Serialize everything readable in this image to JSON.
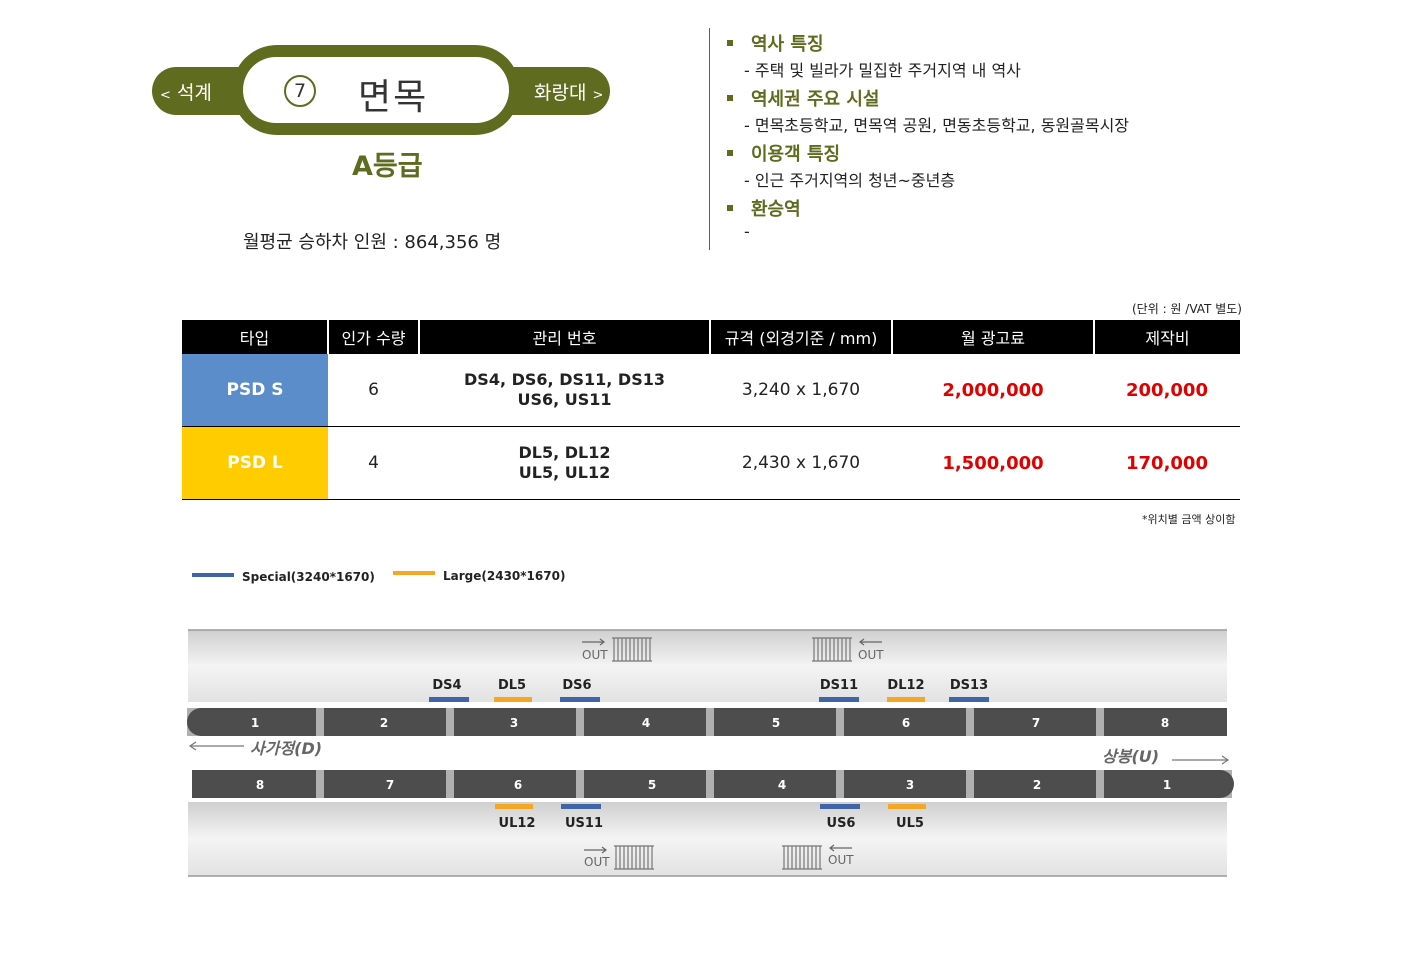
{
  "station": {
    "prev": "석계",
    "prev_arrow": "<",
    "next": "화랑대",
    "next_arrow": ">",
    "number": "7",
    "name": "면목",
    "grade": "A등급",
    "monthly_passengers": "월평균 승하차 인원 : 864,356 명"
  },
  "info": [
    {
      "title": "역사 특징",
      "desc": "-  주택 및 빌라가 밀집한 주거지역 내 역사"
    },
    {
      "title": "역세권 주요 시설",
      "desc": "-  면목초등학교, 면목역 공원, 면동초등학교, 동원골목시장"
    },
    {
      "title": "이용객 특징",
      "desc": "-  인근 주거지역의 청년~중년층"
    },
    {
      "title": "환승역",
      "desc": "-"
    }
  ],
  "unit_note": "(단위 : 원 /VAT 별도)",
  "price_note": "*위치별 금액 상이함",
  "table": {
    "headers": [
      "타입",
      "인가 수량",
      "관리 번호",
      "규격 (외경기준 / mm)",
      "월 광고료",
      "제작비"
    ],
    "rows": [
      {
        "type": "PSD S",
        "qty": "6",
        "mgmt1": "DS4, DS6, DS11, DS13",
        "mgmt2": "US6, US11",
        "size": "3,240  x  1,670",
        "monthly": "2,000,000",
        "production": "200,000"
      },
      {
        "type": "PSD L",
        "qty": "4",
        "mgmt1": "DL5, DL12",
        "mgmt2": "UL5, UL12",
        "size": "2,430  x  1,670",
        "monthly": "1,500,000",
        "production": "170,000"
      }
    ]
  },
  "legend": {
    "special": "Special(3240*1670)",
    "large": "Large(2430*1670)",
    "special_color": "#3f64a8",
    "large_color": "#f5a623"
  },
  "diagram": {
    "out": "OUT",
    "dir_down": "사가정(D)",
    "dir_up": "상봉(U)",
    "top_cars": [
      "1",
      "2",
      "3",
      "4",
      "5",
      "6",
      "7",
      "8"
    ],
    "bottom_cars": [
      "8",
      "7",
      "6",
      "5",
      "4",
      "3",
      "2",
      "1"
    ],
    "top_labels": [
      "DS4",
      "DL5",
      "DS6",
      "DS11",
      "DL12",
      "DS13"
    ],
    "bottom_labels": [
      "UL12",
      "US11",
      "US6",
      "UL5"
    ]
  }
}
